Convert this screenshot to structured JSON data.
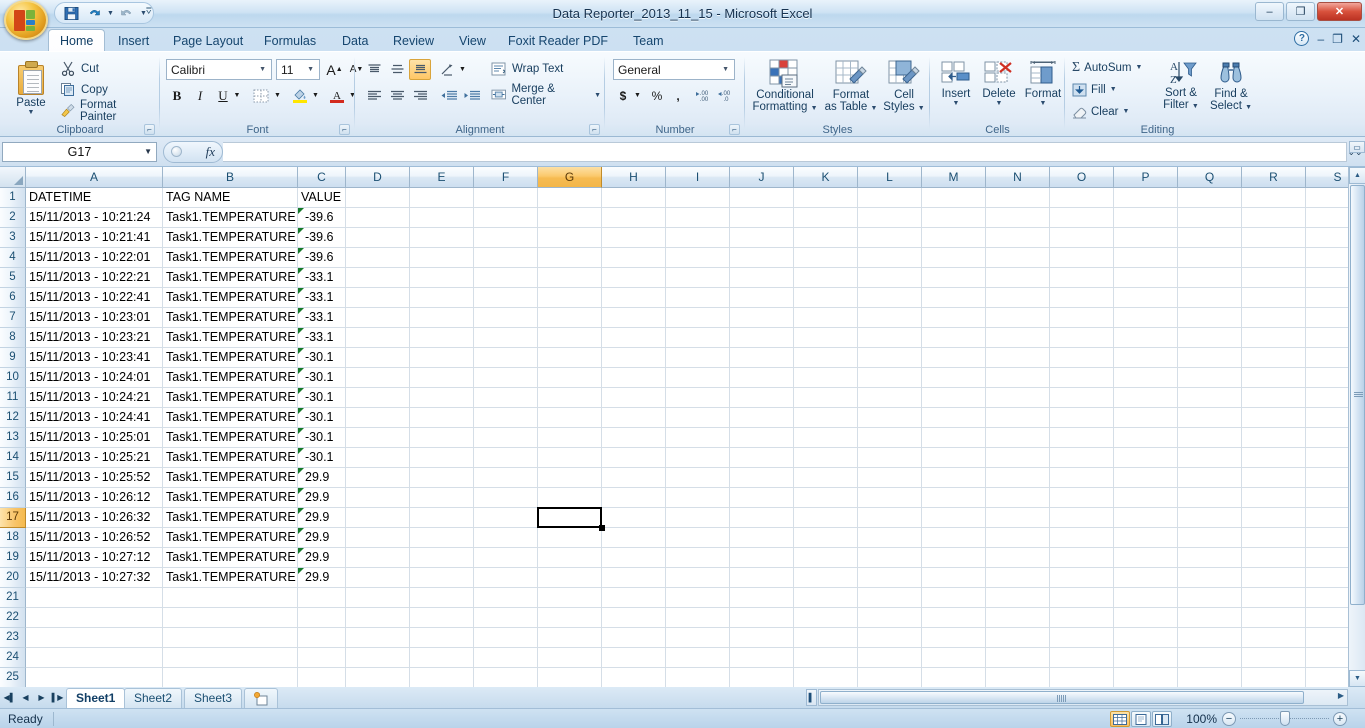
{
  "window": {
    "title": "Data Reporter_2013_11_15 - Microsoft Excel",
    "minimize": "–",
    "restore": "❐",
    "close": "✕"
  },
  "quick_access": {
    "office_button": "Office Button",
    "save": "Save",
    "undo": "Undo",
    "redo": "Redo",
    "customize": "Customize Quick Access Toolbar"
  },
  "tabs": [
    {
      "label": "Home",
      "active": true
    },
    {
      "label": "Insert",
      "active": false
    },
    {
      "label": "Page Layout",
      "active": false
    },
    {
      "label": "Formulas",
      "active": false
    },
    {
      "label": "Data",
      "active": false
    },
    {
      "label": "Review",
      "active": false
    },
    {
      "label": "View",
      "active": false
    },
    {
      "label": "Foxit Reader PDF",
      "active": false
    },
    {
      "label": "Team",
      "active": false
    }
  ],
  "tab_right": {
    "help": "?",
    "minimize_ribbon": "–",
    "restore_window": "❐",
    "close_window": "✕"
  },
  "ribbon": {
    "clipboard": {
      "label": "Clipboard",
      "paste": "Paste",
      "cut": "Cut",
      "copy": "Copy",
      "format_painter": "Format Painter"
    },
    "font": {
      "label": "Font",
      "font_name": "Calibri",
      "font_size": "11",
      "grow_font": "A",
      "shrink_font": "A",
      "bold": "B",
      "italic": "I",
      "underline": "U",
      "borders": "Borders",
      "fill_color": "Fill Color",
      "font_color": "A"
    },
    "alignment": {
      "label": "Alignment",
      "top_align": "Top Align",
      "middle_align": "Middle Align",
      "bottom_align": "Bottom Align",
      "orientation": "Orientation",
      "align_left": "Align Text Left",
      "align_center": "Center",
      "align_right": "Align Text Right",
      "decrease_indent": "Decrease Indent",
      "increase_indent": "Increase Indent",
      "wrap_text": "Wrap Text",
      "merge_center": "Merge & Center"
    },
    "number": {
      "label": "Number",
      "format": "General",
      "accounting": "$",
      "percent": "%",
      "comma": ",",
      "increase_decimal": ".00",
      "decrease_decimal": ".00"
    },
    "styles": {
      "label": "Styles",
      "conditional_formatting_l1": "Conditional",
      "conditional_formatting_l2": "Formatting",
      "format_as_table_l1": "Format",
      "format_as_table_l2": "as Table",
      "cell_styles_l1": "Cell",
      "cell_styles_l2": "Styles"
    },
    "cells": {
      "label": "Cells",
      "insert": "Insert",
      "delete": "Delete",
      "format": "Format"
    },
    "editing": {
      "label": "Editing",
      "autosum": "AutoSum",
      "fill": "Fill",
      "clear": "Clear",
      "sort_filter_l1": "Sort &",
      "sort_filter_l2": "Filter",
      "find_select_l1": "Find &",
      "find_select_l2": "Select"
    }
  },
  "formula_bar": {
    "name_box": "G17",
    "fx": "fx",
    "value": ""
  },
  "grid": {
    "columns": [
      "A",
      "B",
      "C",
      "D",
      "E",
      "F",
      "G",
      "H",
      "I",
      "J",
      "K",
      "L",
      "M",
      "N",
      "O",
      "P",
      "Q",
      "R",
      "S"
    ],
    "selected_column": "G",
    "selected_row": 17,
    "selected_cell": "G17",
    "rows": [
      1,
      2,
      3,
      4,
      5,
      6,
      7,
      8,
      9,
      10,
      11,
      12,
      13,
      14,
      15,
      16,
      17,
      18,
      19,
      20,
      21,
      22,
      23,
      24,
      25
    ],
    "headers": {
      "A": "DATETIME",
      "B": "TAG NAME",
      "C": "VALUE"
    },
    "data": [
      {
        "row": 2,
        "datetime": "15/11/2013 - 10:21:24",
        "tag": "Task1.TEMPERATURE",
        "value": "-39.6",
        "flag": true
      },
      {
        "row": 3,
        "datetime": "15/11/2013 - 10:21:41",
        "tag": "Task1.TEMPERATURE",
        "value": "-39.6",
        "flag": true
      },
      {
        "row": 4,
        "datetime": "15/11/2013 - 10:22:01",
        "tag": "Task1.TEMPERATURE",
        "value": "-39.6",
        "flag": true
      },
      {
        "row": 5,
        "datetime": "15/11/2013 - 10:22:21",
        "tag": "Task1.TEMPERATURE",
        "value": "-33.1",
        "flag": true
      },
      {
        "row": 6,
        "datetime": "15/11/2013 - 10:22:41",
        "tag": "Task1.TEMPERATURE",
        "value": "-33.1",
        "flag": true
      },
      {
        "row": 7,
        "datetime": "15/11/2013 - 10:23:01",
        "tag": "Task1.TEMPERATURE",
        "value": "-33.1",
        "flag": true
      },
      {
        "row": 8,
        "datetime": "15/11/2013 - 10:23:21",
        "tag": "Task1.TEMPERATURE",
        "value": "-33.1",
        "flag": true
      },
      {
        "row": 9,
        "datetime": "15/11/2013 - 10:23:41",
        "tag": "Task1.TEMPERATURE",
        "value": "-30.1",
        "flag": true
      },
      {
        "row": 10,
        "datetime": "15/11/2013 - 10:24:01",
        "tag": "Task1.TEMPERATURE",
        "value": "-30.1",
        "flag": true
      },
      {
        "row": 11,
        "datetime": "15/11/2013 - 10:24:21",
        "tag": "Task1.TEMPERATURE",
        "value": "-30.1",
        "flag": true
      },
      {
        "row": 12,
        "datetime": "15/11/2013 - 10:24:41",
        "tag": "Task1.TEMPERATURE",
        "value": "-30.1",
        "flag": true
      },
      {
        "row": 13,
        "datetime": "15/11/2013 - 10:25:01",
        "tag": "Task1.TEMPERATURE",
        "value": "-30.1",
        "flag": true
      },
      {
        "row": 14,
        "datetime": "15/11/2013 - 10:25:21",
        "tag": "Task1.TEMPERATURE",
        "value": "-30.1",
        "flag": true
      },
      {
        "row": 15,
        "datetime": "15/11/2013 - 10:25:52",
        "tag": "Task1.TEMPERATURE",
        "value": "29.9",
        "flag": true
      },
      {
        "row": 16,
        "datetime": "15/11/2013 - 10:26:12",
        "tag": "Task1.TEMPERATURE",
        "value": "29.9",
        "flag": true
      },
      {
        "row": 17,
        "datetime": "15/11/2013 - 10:26:32",
        "tag": "Task1.TEMPERATURE",
        "value": "29.9",
        "flag": true
      },
      {
        "row": 18,
        "datetime": "15/11/2013 - 10:26:52",
        "tag": "Task1.TEMPERATURE",
        "value": "29.9",
        "flag": true
      },
      {
        "row": 19,
        "datetime": "15/11/2013 - 10:27:12",
        "tag": "Task1.TEMPERATURE",
        "value": "29.9",
        "flag": true
      },
      {
        "row": 20,
        "datetime": "15/11/2013 - 10:27:32",
        "tag": "Task1.TEMPERATURE",
        "value": "29.9",
        "flag": true
      }
    ]
  },
  "sheet_tabs": {
    "first": "◀▌",
    "prev": "◀",
    "next": "▶",
    "last": "▌▶",
    "sheets": [
      {
        "label": "Sheet1",
        "active": true
      },
      {
        "label": "Sheet2",
        "active": false
      },
      {
        "label": "Sheet3",
        "active": false
      }
    ],
    "insert_sheet": "Insert Worksheet"
  },
  "status_bar": {
    "state": "Ready",
    "view_normal": "Normal",
    "view_page_layout": "Page Layout",
    "view_page_break": "Page Break Preview",
    "zoom": "100%",
    "zoom_out": "−",
    "zoom_in": "+"
  },
  "colors": {
    "accent_orange": "#f3b648",
    "selection_border": "#000000",
    "error_flag_green": "#157a2a",
    "ribbon_blue": "#d4e4f2"
  }
}
